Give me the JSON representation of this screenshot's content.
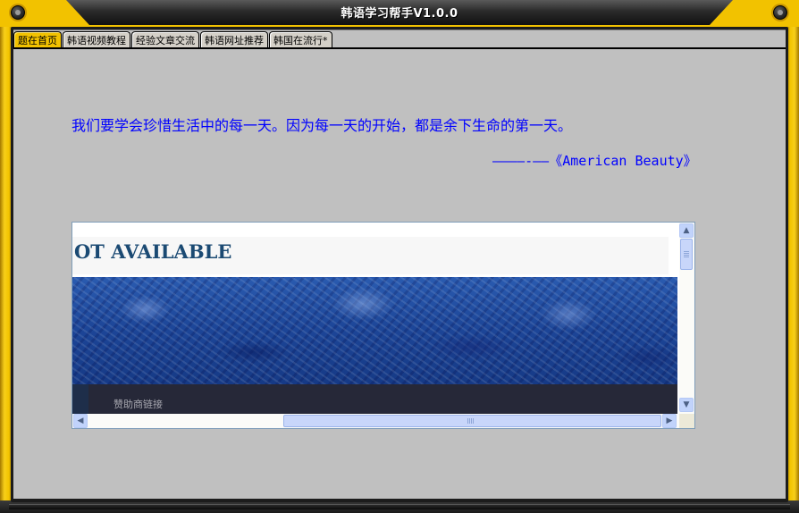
{
  "window": {
    "title": "韩语学习帮手V1.0.0",
    "frame_color": "#f2c200",
    "titlebar_color": "#2a2a2a"
  },
  "tabs": [
    {
      "label": "题在首页",
      "active": true
    },
    {
      "label": "韩语视频教程",
      "active": false
    },
    {
      "label": "经验文章交流",
      "active": false
    },
    {
      "label": "韩语网址推荐",
      "active": false
    },
    {
      "label": "韩国在流行*",
      "active": false
    }
  ],
  "quote": {
    "text": "我们要学会珍惜生活中的每一天。因为每一天的开始，都是余下生命的第一天。",
    "attribution": "————-——《American Beauty》",
    "color": "#0000ff"
  },
  "webview": {
    "heading": "OT AVAILABLE",
    "heading_color": "#1b4a73",
    "banner_color": "#1c4597",
    "footer_link": "赞助商链接",
    "footer_color": "#262838"
  },
  "scrollbars": {
    "up_icon": "arrow-up-icon",
    "down_icon": "arrow-down-icon",
    "left_icon": "arrow-left-icon",
    "right_icon": "arrow-right-icon",
    "up_glyph": "▲",
    "down_glyph": "▼",
    "left_glyph": "◀",
    "right_glyph": "▶"
  }
}
